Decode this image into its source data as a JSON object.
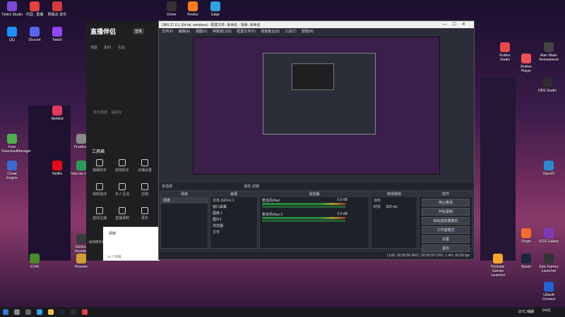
{
  "desktop": {
    "icons": [
      {
        "label": "Twitch Studio",
        "color": "#7b4bd6"
      },
      {
        "label": "乐园 · 直播",
        "color": "#e64040"
      },
      {
        "label": "网易云 音乐",
        "color": "#d43c3c"
      },
      {
        "label": "Driver",
        "color": "#333333"
      },
      {
        "label": "Firefox",
        "color": "#ff7a1a"
      },
      {
        "label": "Edge",
        "color": "#2fa3e0"
      },
      {
        "label": "QQ",
        "color": "#1e90ff"
      },
      {
        "label": "Discord",
        "color": "#5865f2"
      },
      {
        "label": "Twitch",
        "color": "#9146ff"
      },
      {
        "label": "WeMod",
        "color": "#e23b5a"
      },
      {
        "label": "Free DownloadManager",
        "color": "#4caf50"
      },
      {
        "label": "Netflix",
        "color": "#e50914"
      },
      {
        "label": "Prosiliver",
        "color": "#888888"
      },
      {
        "label": "Cheat Engine",
        "color": "#3a6ad0"
      },
      {
        "label": "hide.me VPN",
        "color": "#2c9b5a"
      },
      {
        "label": "GTA5",
        "color": "#4a8a2a"
      },
      {
        "label": "Rockstar Games Launcher",
        "color": "#f5a623"
      },
      {
        "label": "Steam",
        "color": "#1b2838"
      },
      {
        "label": "Epic Games Launcher",
        "color": "#333333"
      },
      {
        "label": "Ubisoft Connect",
        "color": "#2063d6"
      },
      {
        "label": "Roblox Studio",
        "color": "#e44a4a"
      },
      {
        "label": "Roblox Player",
        "color": "#f05050"
      },
      {
        "label": "OBS Studio",
        "color": "#302e31"
      },
      {
        "label": "OpenIV",
        "color": "#2a8ad0"
      },
      {
        "label": "GOG Galaxy",
        "color": "#7a3ab8"
      },
      {
        "label": "Origin",
        "color": "#f56c2d"
      },
      {
        "label": "Alan Wake Remastered",
        "color": "#444444"
      },
      {
        "label": "Resolve",
        "color": "#d0a030"
      },
      {
        "label": "DaVinci Resolve",
        "color": "#3a3a3a"
      }
    ]
  },
  "app_panel": {
    "logo": "直播伴侣",
    "login": "登录",
    "tabs": "场景 素材 互动",
    "empty_hint": "暂无场景，请添加",
    "toolbox": "工具箱",
    "tools": [
      "弹幕助手",
      "房管助手",
      "点播设置",
      "视频连线",
      "多人互动",
      "滤镜",
      "虚拟主播",
      "直播录制",
      "更多"
    ],
    "notice": "如何把手机游戏投屏到电脑上？",
    "white_item": "网络",
    "white_count": "10 个项目"
  },
  "obs": {
    "title": "OBS 27.0.1 (64-bit, windows) - 配置文件: 未命名 - 场景: 未命名",
    "menu": "文件(F) 编辑(E) 视图(V) 停靠窗口(D) 配置文件(P) 场景集合(S) 工具(T) 帮助(H)",
    "scene_label": "未选择",
    "tb_items": "属性 滤镜",
    "docks": {
      "scenes_title": "场景",
      "scenes": [
        "场景"
      ],
      "sources_title": "来源",
      "sources": [
        "文本 (GDI+) 1",
        "窗口采集",
        "图像 1",
        "图片1",
        "浏览器",
        "文字"
      ],
      "mixer_title": "混音器",
      "mixer": [
        {
          "name": "麦克风/Aux",
          "db": "0.0 dB"
        },
        {
          "name": "麦克风/Aux 2",
          "db": "0.0 dB"
        }
      ],
      "transitions_title": "转场特效",
      "transition": "淡出",
      "duration_label": "时长",
      "duration": "300 ms",
      "controls_title": "控件",
      "controls": [
        "停止推流",
        "开始录制",
        "启动虚拟摄像机",
        "工作室模式",
        "设置",
        "退出"
      ]
    },
    "status": "LIVE: 00:00:00   REC: 00:00:00   CPU: 1.4%, 60.00 fps"
  },
  "taskbar": {
    "weather": "15°C 晴朗",
    "time": "14:01"
  }
}
